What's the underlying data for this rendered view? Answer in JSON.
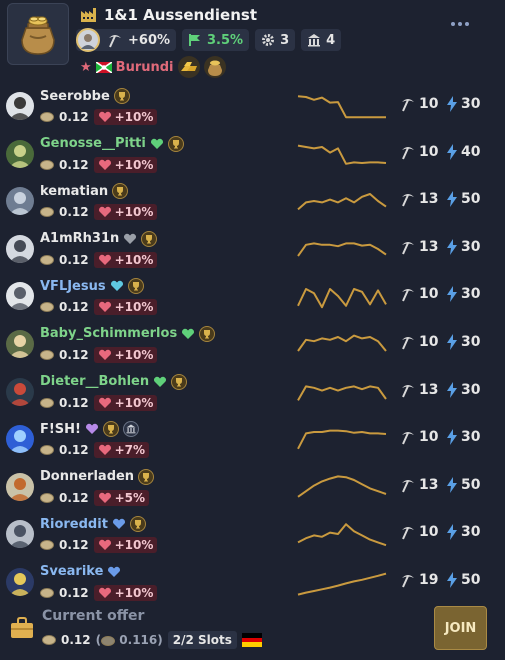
{
  "colors": {
    "background": "#1d2230",
    "sparkline": "#c99a3f",
    "bolt": "#5aa0e6",
    "heart": "#e8697d",
    "country": "#e06a7a"
  },
  "factory": {
    "icon": "coin-sack-icon",
    "title": "1&1 Aussendienst",
    "title_icon": "factory-icon",
    "menu_icon": "more-dots-icon"
  },
  "stats": {
    "bonus": "+60%",
    "flag_percent": "3.5%",
    "gears": "3",
    "buildings": "4"
  },
  "country": {
    "name": "Burundi",
    "resources": [
      "gold-bars-icon",
      "coin-sack-icon"
    ]
  },
  "members": [
    {
      "name": "Seerobbe",
      "name_color": "#e8e8e8",
      "badges": [
        "trophy"
      ],
      "price": "0.12",
      "bonus": "+10%",
      "pick": "10",
      "bolt": "30",
      "avatar_bg": "#dfe3e8",
      "avatar_fg": "#3a3a3a",
      "spark": [
        0.15,
        0.18,
        0.28,
        0.2,
        0.38,
        0.36,
        0.9,
        0.9,
        0.9,
        0.9,
        0.9,
        0.9
      ]
    },
    {
      "name": "Genosse__Pitti",
      "name_color": "#7ed38a",
      "badges": [
        "heart-green",
        "trophy"
      ],
      "price": "0.12",
      "bonus": "+10%",
      "pick": "10",
      "bolt": "40",
      "avatar_bg": "#4a6a3a",
      "avatar_fg": "#c9d28a",
      "spark": [
        0.2,
        0.25,
        0.3,
        0.25,
        0.45,
        0.3,
        0.85,
        0.8,
        0.82,
        0.8,
        0.8,
        0.82
      ]
    },
    {
      "name": "kematian",
      "name_color": "#e8e8e8",
      "badges": [
        "trophy"
      ],
      "price": "0.12",
      "bonus": "+10%",
      "pick": "13",
      "bolt": "50",
      "avatar_bg": "#6f7d92",
      "avatar_fg": "#c9d2de",
      "spark": [
        0.8,
        0.55,
        0.5,
        0.55,
        0.45,
        0.55,
        0.4,
        0.55,
        0.35,
        0.25,
        0.5,
        0.7
      ]
    },
    {
      "name": "A1mRh31n",
      "name_color": "#e8e8e8",
      "badges": [
        "heart-gray",
        "trophy"
      ],
      "price": "0.12",
      "bonus": "+10%",
      "pick": "13",
      "bolt": "30",
      "avatar_bg": "#d5d9e0",
      "avatar_fg": "#454a55",
      "spark": [
        0.75,
        0.35,
        0.3,
        0.35,
        0.35,
        0.4,
        0.3,
        0.3,
        0.38,
        0.35,
        0.5,
        0.7
      ]
    },
    {
      "name": "VFLJesus",
      "name_color": "#8ab8f0",
      "badges": [
        "heart-cyan",
        "trophy"
      ],
      "price": "0.12",
      "bonus": "+10%",
      "pick": "10",
      "bolt": "30",
      "avatar_bg": "#e3e6ea",
      "avatar_fg": "#5a5f6b",
      "spark": [
        0.85,
        0.25,
        0.4,
        0.9,
        0.25,
        0.5,
        0.85,
        0.25,
        0.35,
        0.8,
        0.3,
        0.8
      ]
    },
    {
      "name": "Baby_Schimmerlos",
      "name_color": "#7ed38a",
      "badges": [
        "heart-green",
        "trophy"
      ],
      "price": "0.12",
      "bonus": "+10%",
      "pick": "10",
      "bolt": "30",
      "avatar_bg": "#5a6a45",
      "avatar_fg": "#e7d3a5",
      "spark": [
        0.75,
        0.35,
        0.4,
        0.3,
        0.35,
        0.25,
        0.4,
        0.2,
        0.3,
        0.25,
        0.4,
        0.75
      ]
    },
    {
      "name": "Dieter__Bohlen",
      "name_color": "#7ed38a",
      "badges": [
        "heart-green",
        "trophy"
      ],
      "price": "0.12",
      "bonus": "+10%",
      "pick": "13",
      "bolt": "30",
      "avatar_bg": "#2a3a4a",
      "avatar_fg": "#c94a3a",
      "spark": [
        0.8,
        0.3,
        0.35,
        0.45,
        0.35,
        0.45,
        0.35,
        0.3,
        0.4,
        0.3,
        0.35,
        0.75
      ]
    },
    {
      "name": "F!SH!",
      "name_color": "#e8e8e8",
      "badges": [
        "heart-purple",
        "trophy",
        "bank"
      ],
      "price": "0.12",
      "bonus": "+7%",
      "pick": "10",
      "bolt": "30",
      "avatar_bg": "#2e5fd6",
      "avatar_fg": "#9fd0ff",
      "spark": [
        0.85,
        0.3,
        0.25,
        0.25,
        0.2,
        0.2,
        0.22,
        0.28,
        0.25,
        0.3,
        0.3,
        0.32
      ]
    },
    {
      "name": "Donnerladen",
      "name_color": "#e8e8e8",
      "badges": [
        "trophy"
      ],
      "price": "0.12",
      "bonus": "+5%",
      "pick": "13",
      "bolt": "50",
      "avatar_bg": "#c9c2a8",
      "avatar_fg": "#c26a2e",
      "spark": [
        0.85,
        0.65,
        0.45,
        0.3,
        0.2,
        0.12,
        0.15,
        0.25,
        0.4,
        0.55,
        0.65,
        0.75
      ]
    },
    {
      "name": "Rioreddit",
      "name_color": "#8ab8f0",
      "badges": [
        "heart-blue",
        "trophy"
      ],
      "price": "0.12",
      "bonus": "+10%",
      "pick": "10",
      "bolt": "30",
      "avatar_bg": "#b8bfc9",
      "avatar_fg": "#4a5363",
      "spark": [
        0.8,
        0.65,
        0.55,
        0.6,
        0.45,
        0.5,
        0.15,
        0.4,
        0.55,
        0.7,
        0.8,
        0.9
      ]
    },
    {
      "name": "Svearike",
      "name_color": "#8ab8f0",
      "badges": [
        "heart-blue"
      ],
      "price": "0.12",
      "bonus": "+10%",
      "pick": "19",
      "bolt": "50",
      "avatar_bg": "#2b3a66",
      "avatar_fg": "#e5c85a",
      "spark": [
        0.95,
        0.88,
        0.82,
        0.76,
        0.7,
        0.63,
        0.55,
        0.48,
        0.42,
        0.35,
        0.28,
        0.2
      ]
    }
  ],
  "footer": {
    "label": "Current offer",
    "price": "0.12",
    "alt_price": "0.116",
    "slots": "2/2 Slots",
    "flag": "germany-flag-icon",
    "join_label": "JOIN"
  }
}
